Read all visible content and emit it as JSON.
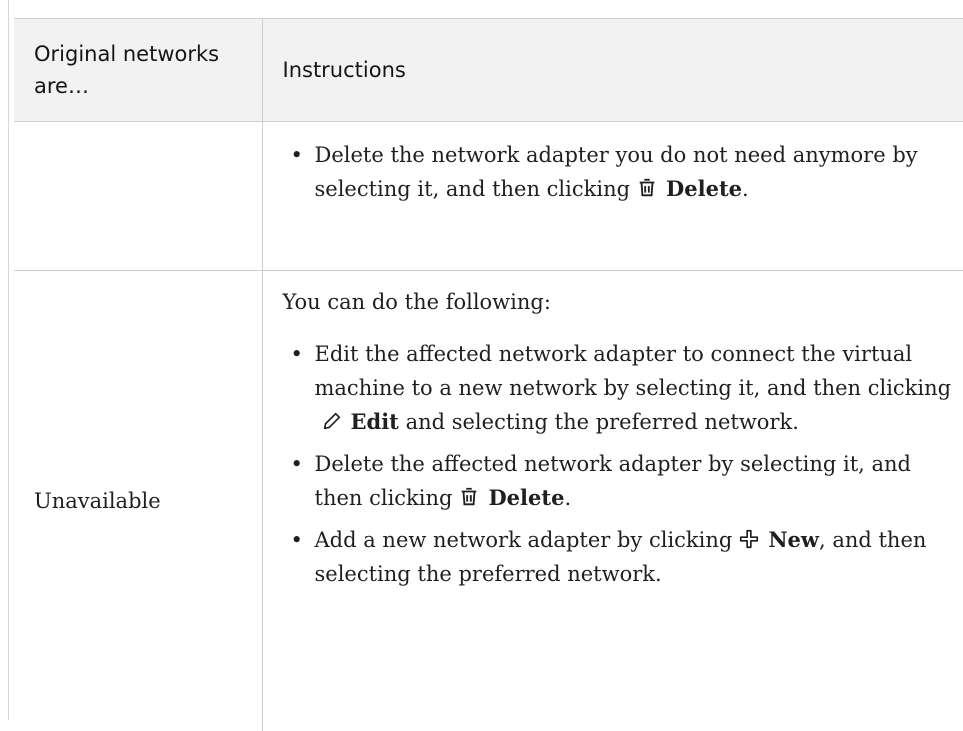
{
  "table": {
    "headers": {
      "col1": "Original networks are…",
      "col2": "Instructions"
    },
    "row1": {
      "col1": "",
      "bullet1": {
        "text_before": "Delete the network adapter you do not need anymore by selecting it, and then clicking",
        "icon": "trash-icon",
        "bold": "Delete",
        "text_after": "."
      }
    },
    "row2": {
      "col1": "Unavailable",
      "lead": "You can do the following:",
      "bullet1": {
        "text_before": "Edit the affected network adapter to connect the virtual machine to a new network by selecting it, and then clicking",
        "icon": "pencil-icon",
        "bold": "Edit",
        "text_after": "and selecting the preferred network."
      },
      "bullet2": {
        "text_before": "Delete the affected network adapter by selecting it, and then clicking",
        "icon": "trash-icon",
        "bold": "Delete",
        "text_after": "."
      },
      "bullet3": {
        "text_before": "Add a new network adapter by clicking",
        "icon": "plus-icon",
        "bold": "New",
        "text_after": ", and then selecting the preferred network."
      }
    }
  }
}
